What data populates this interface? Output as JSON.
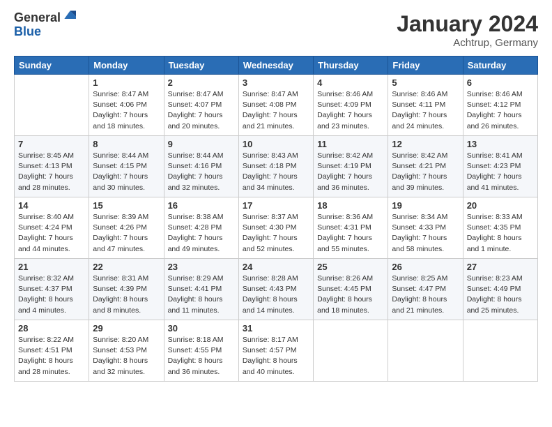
{
  "header": {
    "logo_general": "General",
    "logo_blue": "Blue",
    "title": "January 2024",
    "location": "Achtrup, Germany"
  },
  "weekdays": [
    "Sunday",
    "Monday",
    "Tuesday",
    "Wednesday",
    "Thursday",
    "Friday",
    "Saturday"
  ],
  "weeks": [
    [
      {
        "day": "",
        "info": ""
      },
      {
        "day": "1",
        "info": "Sunrise: 8:47 AM\nSunset: 4:06 PM\nDaylight: 7 hours\nand 18 minutes."
      },
      {
        "day": "2",
        "info": "Sunrise: 8:47 AM\nSunset: 4:07 PM\nDaylight: 7 hours\nand 20 minutes."
      },
      {
        "day": "3",
        "info": "Sunrise: 8:47 AM\nSunset: 4:08 PM\nDaylight: 7 hours\nand 21 minutes."
      },
      {
        "day": "4",
        "info": "Sunrise: 8:46 AM\nSunset: 4:09 PM\nDaylight: 7 hours\nand 23 minutes."
      },
      {
        "day": "5",
        "info": "Sunrise: 8:46 AM\nSunset: 4:11 PM\nDaylight: 7 hours\nand 24 minutes."
      },
      {
        "day": "6",
        "info": "Sunrise: 8:46 AM\nSunset: 4:12 PM\nDaylight: 7 hours\nand 26 minutes."
      }
    ],
    [
      {
        "day": "7",
        "info": "Sunrise: 8:45 AM\nSunset: 4:13 PM\nDaylight: 7 hours\nand 28 minutes."
      },
      {
        "day": "8",
        "info": "Sunrise: 8:44 AM\nSunset: 4:15 PM\nDaylight: 7 hours\nand 30 minutes."
      },
      {
        "day": "9",
        "info": "Sunrise: 8:44 AM\nSunset: 4:16 PM\nDaylight: 7 hours\nand 32 minutes."
      },
      {
        "day": "10",
        "info": "Sunrise: 8:43 AM\nSunset: 4:18 PM\nDaylight: 7 hours\nand 34 minutes."
      },
      {
        "day": "11",
        "info": "Sunrise: 8:42 AM\nSunset: 4:19 PM\nDaylight: 7 hours\nand 36 minutes."
      },
      {
        "day": "12",
        "info": "Sunrise: 8:42 AM\nSunset: 4:21 PM\nDaylight: 7 hours\nand 39 minutes."
      },
      {
        "day": "13",
        "info": "Sunrise: 8:41 AM\nSunset: 4:23 PM\nDaylight: 7 hours\nand 41 minutes."
      }
    ],
    [
      {
        "day": "14",
        "info": "Sunrise: 8:40 AM\nSunset: 4:24 PM\nDaylight: 7 hours\nand 44 minutes."
      },
      {
        "day": "15",
        "info": "Sunrise: 8:39 AM\nSunset: 4:26 PM\nDaylight: 7 hours\nand 47 minutes."
      },
      {
        "day": "16",
        "info": "Sunrise: 8:38 AM\nSunset: 4:28 PM\nDaylight: 7 hours\nand 49 minutes."
      },
      {
        "day": "17",
        "info": "Sunrise: 8:37 AM\nSunset: 4:30 PM\nDaylight: 7 hours\nand 52 minutes."
      },
      {
        "day": "18",
        "info": "Sunrise: 8:36 AM\nSunset: 4:31 PM\nDaylight: 7 hours\nand 55 minutes."
      },
      {
        "day": "19",
        "info": "Sunrise: 8:34 AM\nSunset: 4:33 PM\nDaylight: 7 hours\nand 58 minutes."
      },
      {
        "day": "20",
        "info": "Sunrise: 8:33 AM\nSunset: 4:35 PM\nDaylight: 8 hours\nand 1 minute."
      }
    ],
    [
      {
        "day": "21",
        "info": "Sunrise: 8:32 AM\nSunset: 4:37 PM\nDaylight: 8 hours\nand 4 minutes."
      },
      {
        "day": "22",
        "info": "Sunrise: 8:31 AM\nSunset: 4:39 PM\nDaylight: 8 hours\nand 8 minutes."
      },
      {
        "day": "23",
        "info": "Sunrise: 8:29 AM\nSunset: 4:41 PM\nDaylight: 8 hours\nand 11 minutes."
      },
      {
        "day": "24",
        "info": "Sunrise: 8:28 AM\nSunset: 4:43 PM\nDaylight: 8 hours\nand 14 minutes."
      },
      {
        "day": "25",
        "info": "Sunrise: 8:26 AM\nSunset: 4:45 PM\nDaylight: 8 hours\nand 18 minutes."
      },
      {
        "day": "26",
        "info": "Sunrise: 8:25 AM\nSunset: 4:47 PM\nDaylight: 8 hours\nand 21 minutes."
      },
      {
        "day": "27",
        "info": "Sunrise: 8:23 AM\nSunset: 4:49 PM\nDaylight: 8 hours\nand 25 minutes."
      }
    ],
    [
      {
        "day": "28",
        "info": "Sunrise: 8:22 AM\nSunset: 4:51 PM\nDaylight: 8 hours\nand 28 minutes."
      },
      {
        "day": "29",
        "info": "Sunrise: 8:20 AM\nSunset: 4:53 PM\nDaylight: 8 hours\nand 32 minutes."
      },
      {
        "day": "30",
        "info": "Sunrise: 8:18 AM\nSunset: 4:55 PM\nDaylight: 8 hours\nand 36 minutes."
      },
      {
        "day": "31",
        "info": "Sunrise: 8:17 AM\nSunset: 4:57 PM\nDaylight: 8 hours\nand 40 minutes."
      },
      {
        "day": "",
        "info": ""
      },
      {
        "day": "",
        "info": ""
      },
      {
        "day": "",
        "info": ""
      }
    ]
  ]
}
